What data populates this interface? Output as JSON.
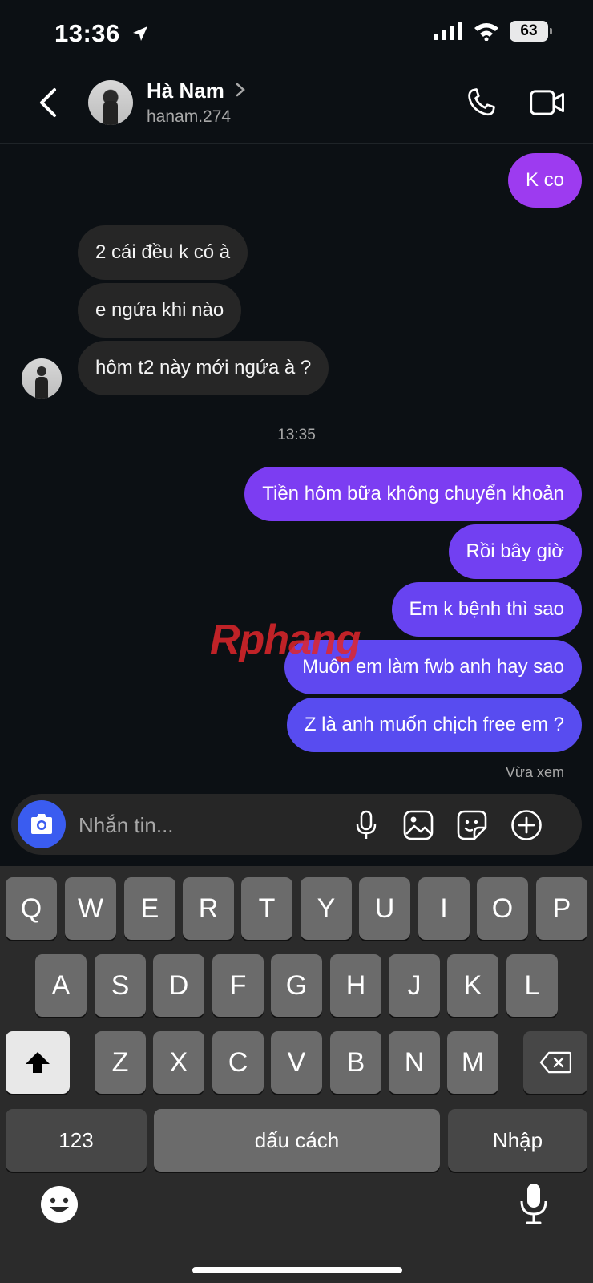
{
  "status_bar": {
    "time": "13:36",
    "battery": "63"
  },
  "header": {
    "name": "Hà Nam",
    "username": "hanam.274"
  },
  "messages": [
    {
      "side": "out",
      "text": "K co"
    },
    {
      "side": "in",
      "text": "2 cái đều k có à"
    },
    {
      "side": "in",
      "text": "e ngứa khi nào"
    },
    {
      "side": "in",
      "text": "hôm t2 này mới ngứa à ?"
    },
    {
      "side": "out",
      "text": "Tiền hôm bữa không chuyển khoản"
    },
    {
      "side": "out",
      "text": "Rồi bây giờ"
    },
    {
      "side": "out",
      "text": "Em k bệnh thì sao"
    },
    {
      "side": "out",
      "text": "Muốn em làm fwb anh hay sao"
    },
    {
      "side": "out",
      "text": "Z là anh muốn chịch free em ?"
    }
  ],
  "timestamp": "13:35",
  "seen_label": "Vừa xem",
  "watermark": "Rphang",
  "composer": {
    "placeholder": "Nhắn tin..."
  },
  "keyboard": {
    "row1": [
      "Q",
      "W",
      "E",
      "R",
      "T",
      "Y",
      "U",
      "I",
      "O",
      "P"
    ],
    "row2": [
      "A",
      "S",
      "D",
      "F",
      "G",
      "H",
      "J",
      "K",
      "L"
    ],
    "row3": [
      "Z",
      "X",
      "C",
      "V",
      "B",
      "N",
      "M"
    ],
    "numbers_label": "123",
    "space_label": "dấu cách",
    "return_label": "Nhập"
  },
  "colors": {
    "outgoing_top": "#9b3cf0",
    "outgoing_bottom": "#5a4ff0",
    "incoming": "#262626",
    "camera_button": "#3a5cf0"
  }
}
